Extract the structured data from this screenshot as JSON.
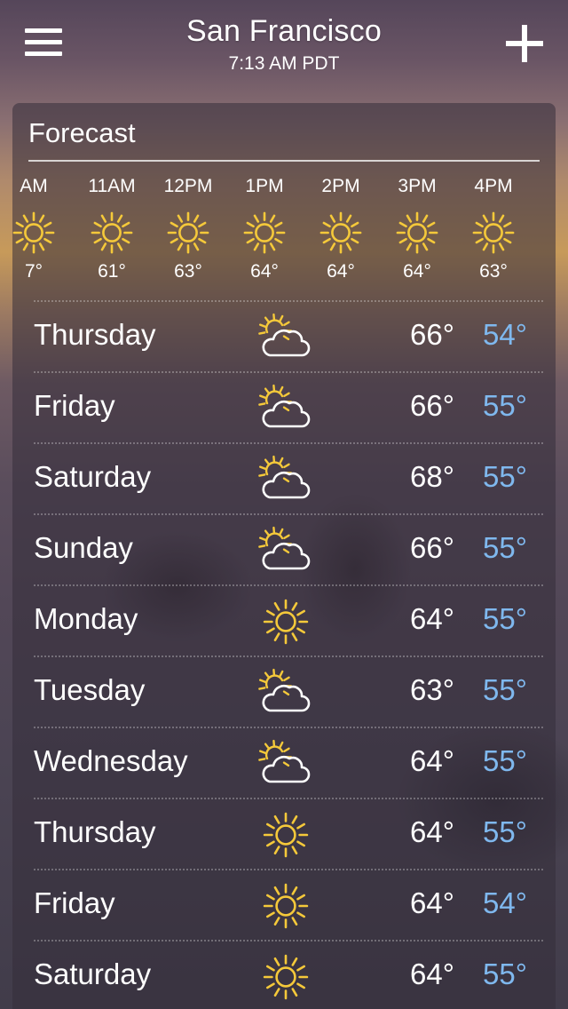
{
  "header": {
    "city": "San Francisco",
    "time": "7:13 AM PDT",
    "menu_icon": "hamburger-menu-icon",
    "add_icon": "plus-icon"
  },
  "forecast": {
    "title": "Forecast",
    "hourly": [
      {
        "label": "AM",
        "temp": "7°",
        "icon": "sun-icon"
      },
      {
        "label": "11AM",
        "temp": "61°",
        "icon": "sun-icon"
      },
      {
        "label": "12PM",
        "temp": "63°",
        "icon": "sun-icon"
      },
      {
        "label": "1PM",
        "temp": "64°",
        "icon": "sun-icon"
      },
      {
        "label": "2PM",
        "temp": "64°",
        "icon": "sun-icon"
      },
      {
        "label": "3PM",
        "temp": "64°",
        "icon": "sun-icon"
      },
      {
        "label": "4PM",
        "temp": "63°",
        "icon": "sun-icon"
      }
    ],
    "daily": [
      {
        "day": "Thursday",
        "icon": "partly-cloudy-icon",
        "high": "66°",
        "low": "54°"
      },
      {
        "day": "Friday",
        "icon": "partly-cloudy-icon",
        "high": "66°",
        "low": "55°"
      },
      {
        "day": "Saturday",
        "icon": "partly-cloudy-icon",
        "high": "68°",
        "low": "55°"
      },
      {
        "day": "Sunday",
        "icon": "partly-cloudy-icon",
        "high": "66°",
        "low": "55°"
      },
      {
        "day": "Monday",
        "icon": "sun-icon",
        "high": "64°",
        "low": "55°"
      },
      {
        "day": "Tuesday",
        "icon": "partly-cloudy-icon",
        "high": "63°",
        "low": "55°"
      },
      {
        "day": "Wednesday",
        "icon": "partly-cloudy-icon",
        "high": "64°",
        "low": "55°"
      },
      {
        "day": "Thursday",
        "icon": "sun-icon",
        "high": "64°",
        "low": "55°"
      },
      {
        "day": "Friday",
        "icon": "sun-icon",
        "high": "64°",
        "low": "54°"
      },
      {
        "day": "Saturday",
        "icon": "sun-icon",
        "high": "64°",
        "low": "55°"
      }
    ]
  },
  "colors": {
    "sun": "#f5c93a",
    "low_temp": "#7fb8ee",
    "text": "#ffffff"
  }
}
